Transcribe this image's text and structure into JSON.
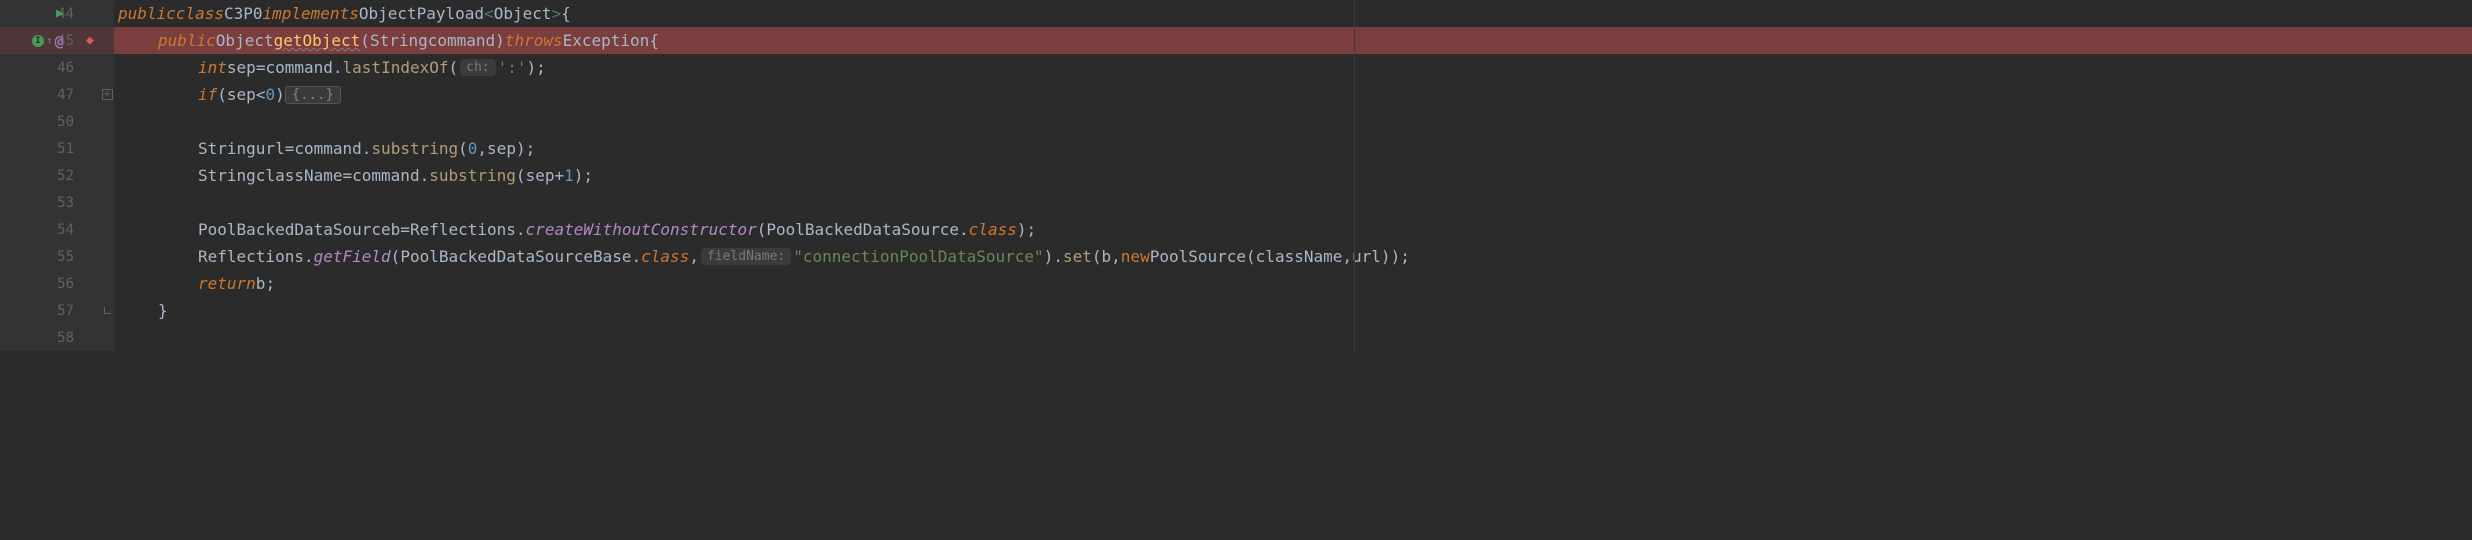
{
  "lines": {
    "l44": "44",
    "l45": "45",
    "l46": "46",
    "l47": "47",
    "l50": "50",
    "l51": "51",
    "l52": "52",
    "l53": "53",
    "l54": "54",
    "l55": "55",
    "l56": "56",
    "l57": "57",
    "l58": "58"
  },
  "markers": {
    "at": "@"
  },
  "code": {
    "kw_public": "public",
    "kw_class": "class",
    "kw_implements": "implements",
    "kw_throws": "throws",
    "kw_int": "int",
    "kw_if": "if",
    "kw_return": "return",
    "kw_new": "new",
    "cls_c3p0": "C3P0",
    "cls_objpayload": "ObjectPayload",
    "cls_object": "Object",
    "cls_string": "String",
    "cls_exception": "Exception",
    "cls_pbds": "PoolBackedDataSource",
    "cls_pbdsb": "PoolBackedDataSourceBase",
    "cls_reflections": "Reflections",
    "cls_poolsource": "PoolSource",
    "m_getobject": "getObject",
    "m_lastindexof": "lastIndexOf",
    "m_substring": "substring",
    "m_createwc": "createWithoutConstructor",
    "m_getfield": "getField",
    "m_set": "set",
    "v_command": "command",
    "v_sep": "sep",
    "v_url": "url",
    "v_classname": "className",
    "v_b": "b",
    "hint_ch": "ch:",
    "hint_fieldname": "fieldName:",
    "str_colon": "':'",
    "str_cpds": "\"connectionPoolDataSource\"",
    "num_0": "0",
    "num_1": "1",
    "folded": "{...}",
    "dot_class": "class",
    "generic_open": "<",
    "generic_close": ">",
    "space": " ",
    "open_paren": "(",
    "close_paren": ")",
    "open_brace": "{",
    "close_brace": "}",
    "semicolon": ";",
    "comma": ",",
    "eq": " = ",
    "lt": " < ",
    "plus": " + ",
    "dot": "."
  }
}
